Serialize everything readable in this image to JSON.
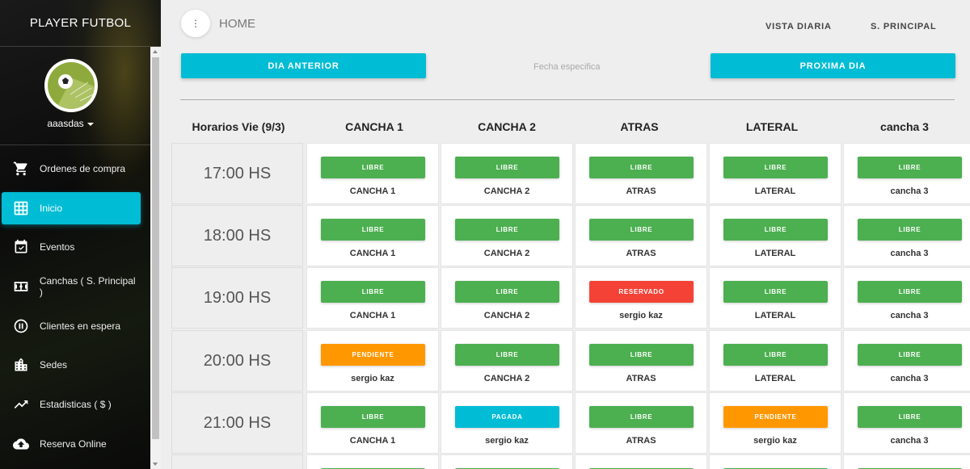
{
  "app": {
    "brand": "PLAYER FUTBOL",
    "username": "aaasdas"
  },
  "sidebar": {
    "items": [
      {
        "label": "Ordenes de compra",
        "icon": "cart-icon"
      },
      {
        "label": "Inicio",
        "icon": "grid-icon",
        "active": true
      },
      {
        "label": "Eventos",
        "icon": "calendar-icon"
      },
      {
        "label": "Canchas ( S. Principal )",
        "icon": "field-icon"
      },
      {
        "label": "Clientes en espera",
        "icon": "pause-icon"
      },
      {
        "label": "Sedes",
        "icon": "building-icon"
      },
      {
        "label": "Estadisticas ( $ )",
        "icon": "trending-icon"
      },
      {
        "label": "Reserva Online",
        "icon": "cloud-upload-icon"
      }
    ]
  },
  "header": {
    "title": "HOME",
    "link_daily": "VISTA DIARIA",
    "link_principal": "S. PRINCIPAL",
    "menu_icon": "more-vert-icon"
  },
  "controls": {
    "prev": "DIA ANTERIOR",
    "date_placeholder": "Fecha especifica",
    "next": "PROXIMA DIA"
  },
  "schedule": {
    "time_header": "Horarios Vie (9/3)",
    "courts": [
      "CANCHA 1",
      "CANCHA 2",
      "ATRAS",
      "LATERAL",
      "cancha 3"
    ],
    "rows": [
      {
        "time": "17:00 HS",
        "cells": [
          {
            "status": "LIBRE",
            "label": "CANCHA 1"
          },
          {
            "status": "LIBRE",
            "label": "CANCHA 2"
          },
          {
            "status": "LIBRE",
            "label": "ATRAS"
          },
          {
            "status": "LIBRE",
            "label": "LATERAL"
          },
          {
            "status": "LIBRE",
            "label": "cancha 3"
          }
        ]
      },
      {
        "time": "18:00 HS",
        "cells": [
          {
            "status": "LIBRE",
            "label": "CANCHA 1"
          },
          {
            "status": "LIBRE",
            "label": "CANCHA 2"
          },
          {
            "status": "LIBRE",
            "label": "ATRAS"
          },
          {
            "status": "LIBRE",
            "label": "LATERAL"
          },
          {
            "status": "LIBRE",
            "label": "cancha 3"
          }
        ]
      },
      {
        "time": "19:00 HS",
        "cells": [
          {
            "status": "LIBRE",
            "label": "CANCHA 1"
          },
          {
            "status": "LIBRE",
            "label": "CANCHA 2"
          },
          {
            "status": "RESERVADO",
            "label": "sergio kaz"
          },
          {
            "status": "LIBRE",
            "label": "LATERAL"
          },
          {
            "status": "LIBRE",
            "label": "cancha 3"
          }
        ]
      },
      {
        "time": "20:00 HS",
        "cells": [
          {
            "status": "PENDIENTE",
            "label": "sergio kaz"
          },
          {
            "status": "LIBRE",
            "label": "CANCHA 2"
          },
          {
            "status": "LIBRE",
            "label": "ATRAS"
          },
          {
            "status": "LIBRE",
            "label": "LATERAL"
          },
          {
            "status": "LIBRE",
            "label": "cancha 3"
          }
        ]
      },
      {
        "time": "21:00 HS",
        "cells": [
          {
            "status": "LIBRE",
            "label": "CANCHA 1"
          },
          {
            "status": "PAGADA",
            "label": "sergio kaz"
          },
          {
            "status": "LIBRE",
            "label": "ATRAS"
          },
          {
            "status": "PENDIENTE",
            "label": "sergio kaz"
          },
          {
            "status": "LIBRE",
            "label": "cancha 3"
          }
        ]
      }
    ]
  },
  "colors": {
    "accent": "#00bcd4",
    "libre": "#4caf50",
    "reservado": "#f44336",
    "pendiente": "#ff9800",
    "pagada": "#00bcd4"
  }
}
